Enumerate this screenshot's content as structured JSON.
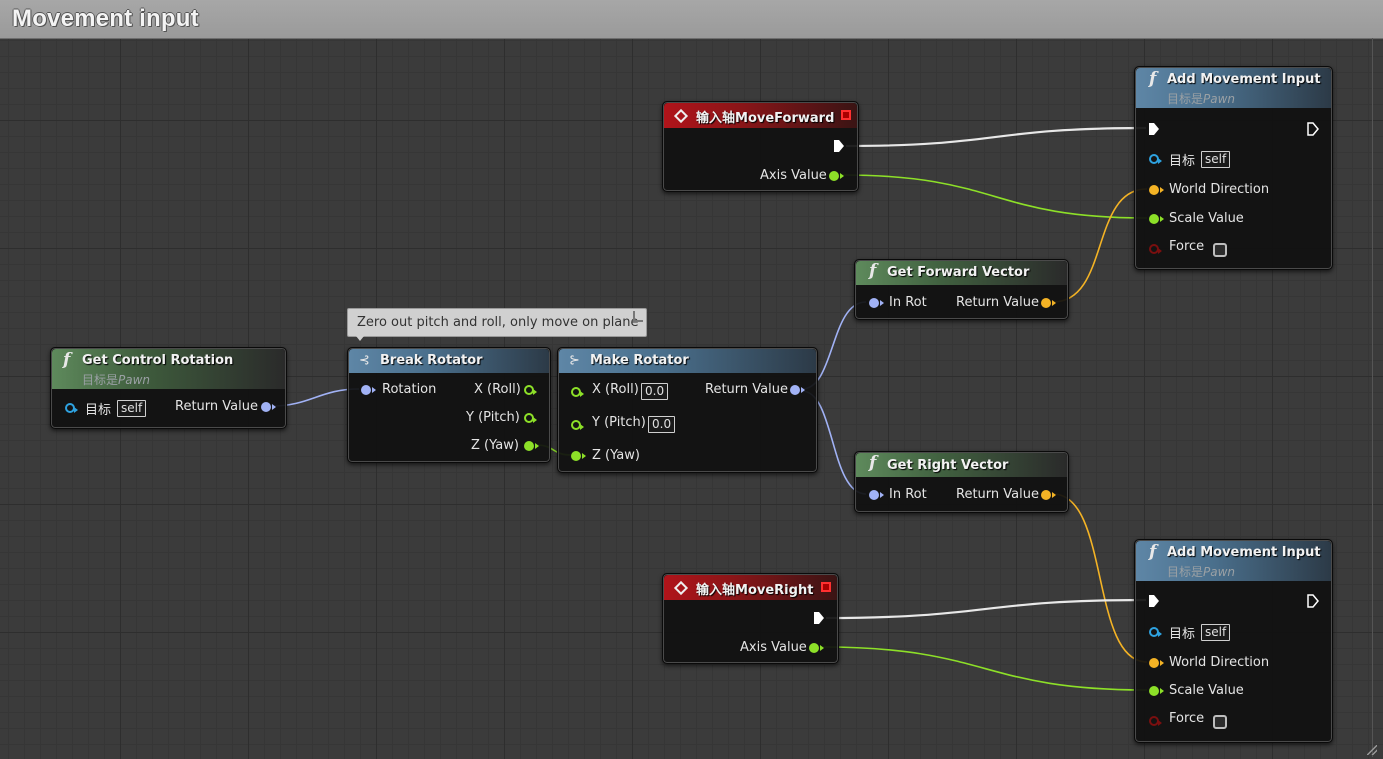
{
  "comment": {
    "title": "Movement input"
  },
  "tooltip": {
    "text": "Zero out pitch and roll, only move on plane"
  },
  "nodes": {
    "get_control_rotation": {
      "title": "Get Control Rotation",
      "subtitle_prefix": "目标是",
      "subtitle_target": "Pawn",
      "target_label": "目标",
      "target_value": "self",
      "return_label": "Return Value"
    },
    "break_rotator": {
      "title": "Break Rotator",
      "input_label": "Rotation",
      "outputs": [
        "X (Roll)",
        "Y (Pitch)",
        "Z (Yaw)"
      ]
    },
    "make_rotator": {
      "title": "Make Rotator",
      "inputs": [
        {
          "label": "X (Roll)",
          "value": "0.0"
        },
        {
          "label": "Y (Pitch)",
          "value": "0.0"
        },
        {
          "label": "Z (Yaw)"
        }
      ],
      "return_label": "Return Value"
    },
    "input_move_forward": {
      "title_prefix": "输入轴",
      "title_name": "MoveForward",
      "axis_label": "Axis Value"
    },
    "input_move_right": {
      "title_prefix": "输入轴",
      "title_name": "MoveRight",
      "axis_label": "Axis Value"
    },
    "get_forward_vector": {
      "title": "Get Forward Vector",
      "input_label": "In Rot",
      "return_label": "Return Value"
    },
    "get_right_vector": {
      "title": "Get Right Vector",
      "input_label": "In Rot",
      "return_label": "Return Value"
    },
    "add_movement_input_1": {
      "title": "Add Movement Input",
      "subtitle_prefix": "目标是",
      "subtitle_target": "Pawn",
      "target_label": "目标",
      "target_value": "self",
      "world_direction_label": "World Direction",
      "scale_value_label": "Scale Value",
      "force_label": "Force"
    },
    "add_movement_input_2": {
      "title": "Add Movement Input",
      "subtitle_prefix": "目标是",
      "subtitle_target": "Pawn",
      "target_label": "目标",
      "target_value": "self",
      "world_direction_label": "World Direction",
      "scale_value_label": "Scale Value",
      "force_label": "Force"
    }
  },
  "colors": {
    "exec_wire": "#e8e8e8",
    "float_wire": "#8de028",
    "vector_wire": "#f4b325",
    "rotator_wire": "#a1b2f5"
  }
}
